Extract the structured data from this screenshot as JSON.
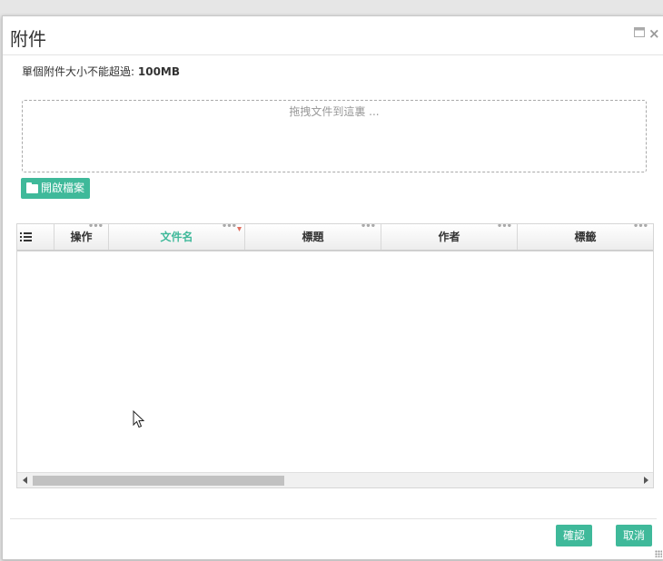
{
  "dialog": {
    "title": "附件",
    "controls": {
      "maximize_icon": "maximize-icon",
      "close_symbol": "×"
    }
  },
  "upload": {
    "size_limit_label": "單個附件大小不能超過:",
    "size_limit_value": "100MB",
    "dropzone_text": "拖拽文件到這裏 ...",
    "open_button_label": "開啟檔案"
  },
  "grid": {
    "columns": [
      {
        "label": "操作"
      },
      {
        "label": "文件名",
        "sorted": true
      },
      {
        "label": "標題"
      },
      {
        "label": "作者"
      },
      {
        "label": "標籤"
      }
    ],
    "rows": []
  },
  "footer": {
    "confirm_label": "確認",
    "cancel_label": "取消"
  },
  "colors": {
    "accent": "#3fb99a"
  }
}
